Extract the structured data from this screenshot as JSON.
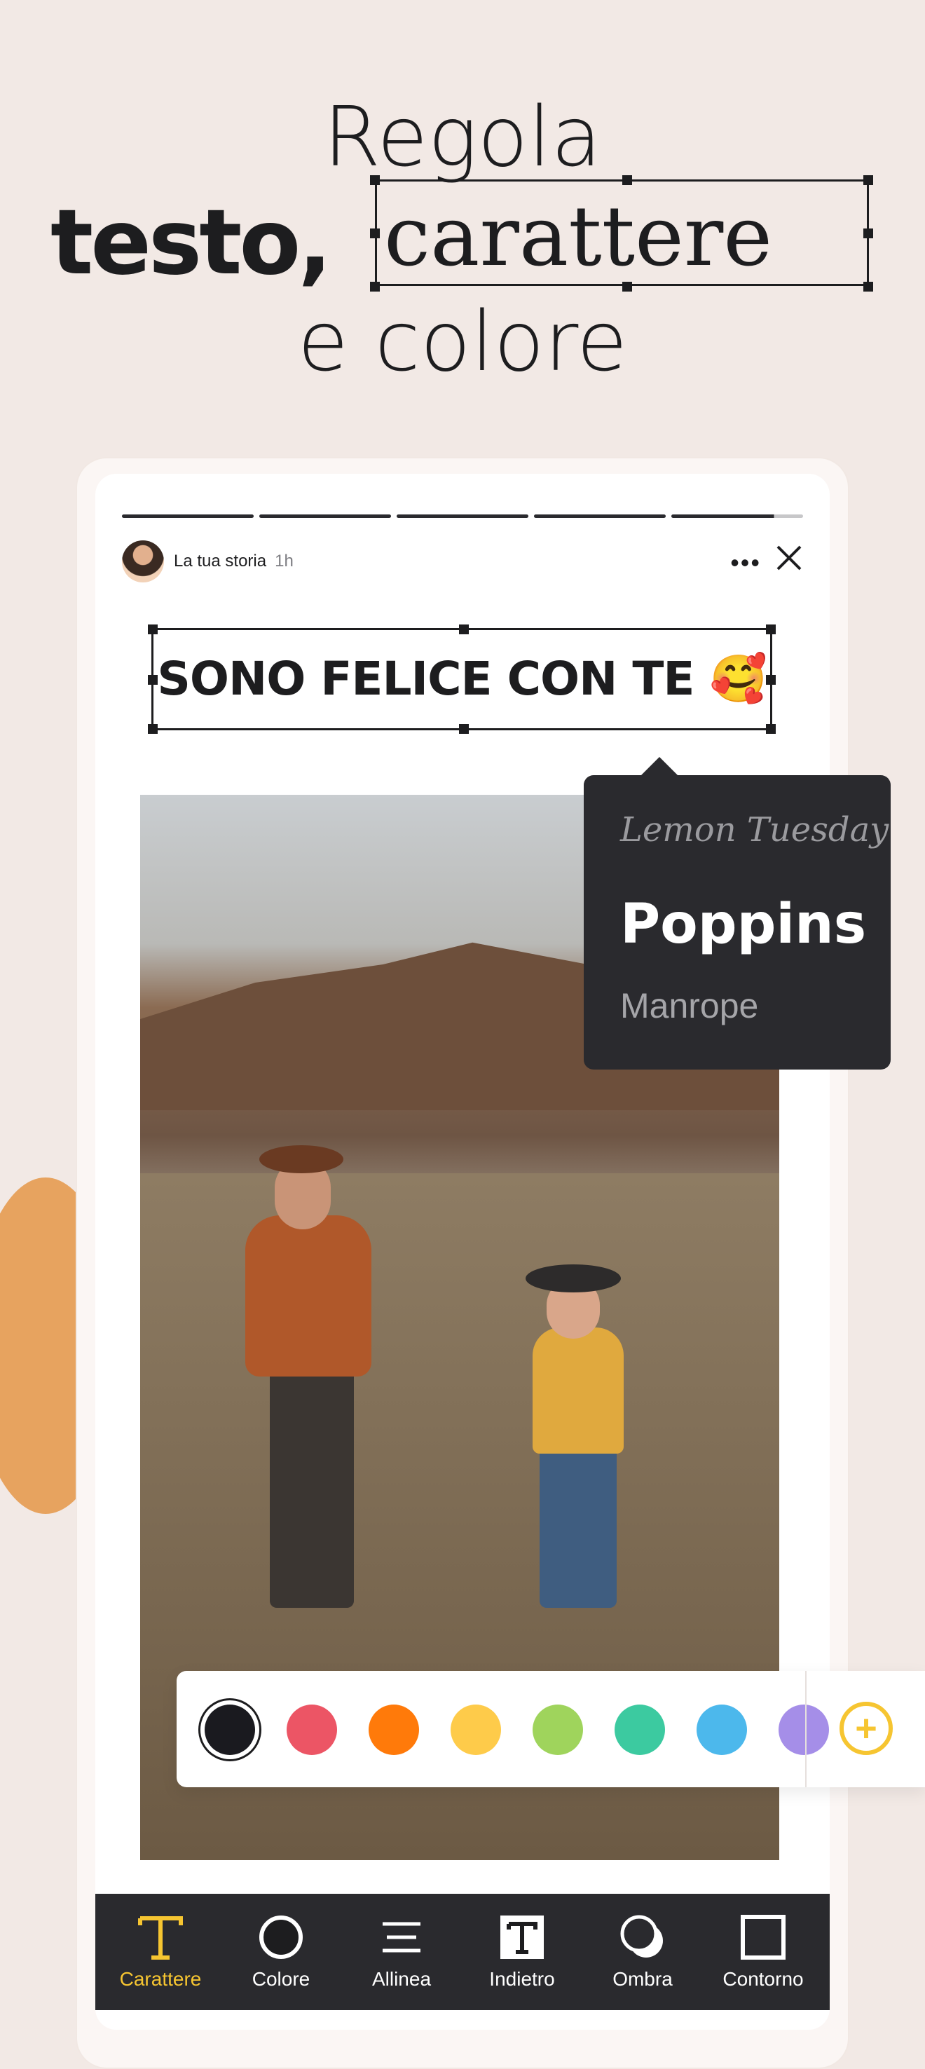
{
  "headline": {
    "line1": "Regola",
    "line2_bold": "testo,",
    "line2_serif": "carattere",
    "line3": "e colore"
  },
  "story": {
    "name": "La tua storia",
    "time": "1h",
    "more_icon": "more-dots-icon",
    "close_icon": "close-icon",
    "progress_segments": 5
  },
  "text_box": {
    "text": "SONO FELICE CON TE 🥰"
  },
  "font_menu": {
    "items": [
      "Lemon Tuesday",
      "Poppins",
      "Manrope"
    ],
    "selected": "Poppins"
  },
  "palette": {
    "colors": [
      "#1a1a1f",
      "#ec5565",
      "#ff7a0a",
      "#fecb4a",
      "#9fd45c",
      "#3ccaa0",
      "#4cb8ec",
      "#a58ee8"
    ],
    "selected_index": 0,
    "add_icon": "add-circle-icon",
    "accent": "#f6c531"
  },
  "toolbar": {
    "items": [
      {
        "label": "Carattere",
        "icon": "text-t-icon",
        "active": true
      },
      {
        "label": "Colore",
        "icon": "color-circle-icon",
        "active": false
      },
      {
        "label": "Allinea",
        "icon": "align-lines-icon",
        "active": false
      },
      {
        "label": "Indietro",
        "icon": "text-background-icon",
        "active": false
      },
      {
        "label": "Ombra",
        "icon": "shadow-icon",
        "active": false
      },
      {
        "label": "Contorno",
        "icon": "outline-icon",
        "active": false
      }
    ]
  }
}
